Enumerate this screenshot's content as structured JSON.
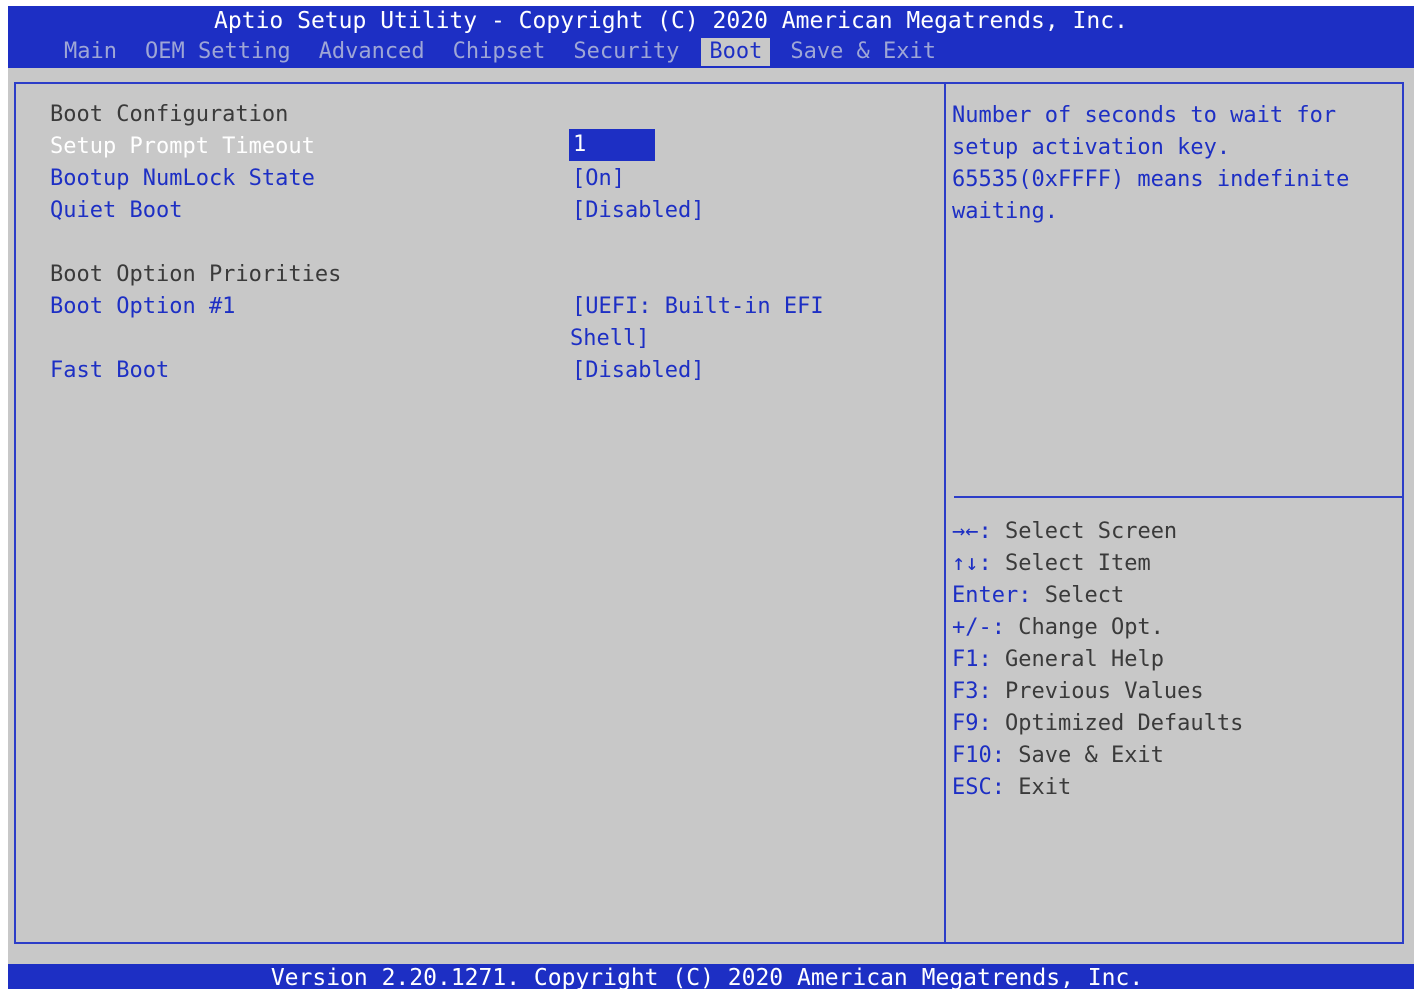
{
  "header": {
    "title": "Aptio Setup Utility - Copyright (C) 2020 American Megatrends, Inc.",
    "tabs": [
      "Main",
      "OEM Setting",
      "Advanced",
      "Chipset",
      "Security",
      "Boot",
      "Save & Exit"
    ],
    "active_tab": "Boot"
  },
  "settings": {
    "boot_config_header": "Boot Configuration",
    "setup_prompt_timeout": {
      "label": "Setup Prompt Timeout",
      "value": "1"
    },
    "bootup_numlock_state": {
      "label": "Bootup NumLock State",
      "value": "[On]"
    },
    "quiet_boot": {
      "label": "Quiet Boot",
      "value": "[Disabled]"
    },
    "boot_option_priorities_header": "Boot Option Priorities",
    "boot_option_1": {
      "label": "Boot Option #1",
      "value_line1": "[UEFI: Built-in EFI",
      "value_line2": "Shell]"
    },
    "fast_boot": {
      "label": "Fast Boot",
      "value": "[Disabled]"
    }
  },
  "help": {
    "lines": [
      "Number of seconds to wait for",
      "setup activation key.",
      "65535(0xFFFF) means indefinite",
      "waiting."
    ]
  },
  "keys": [
    {
      "key": "→←:",
      "desc": " Select Screen"
    },
    {
      "key": "↑↓:",
      "desc": " Select Item"
    },
    {
      "key": "Enter:",
      "desc": " Select"
    },
    {
      "key": "+/-:",
      "desc": " Change Opt."
    },
    {
      "key": "F1:",
      "desc": " General Help"
    },
    {
      "key": "F3:",
      "desc": " Previous Values"
    },
    {
      "key": "F9:",
      "desc": " Optimized Defaults"
    },
    {
      "key": "F10:",
      "desc": " Save & Exit"
    },
    {
      "key": "ESC:",
      "desc": " Exit"
    }
  ],
  "footer": {
    "version": "Version 2.20.1271. Copyright (C) 2020 American Megatrends, Inc."
  },
  "colors": {
    "bar_blue": "#1d2fc4",
    "panel_gray": "#c8c8c8",
    "selected_text": "#ffffff"
  }
}
